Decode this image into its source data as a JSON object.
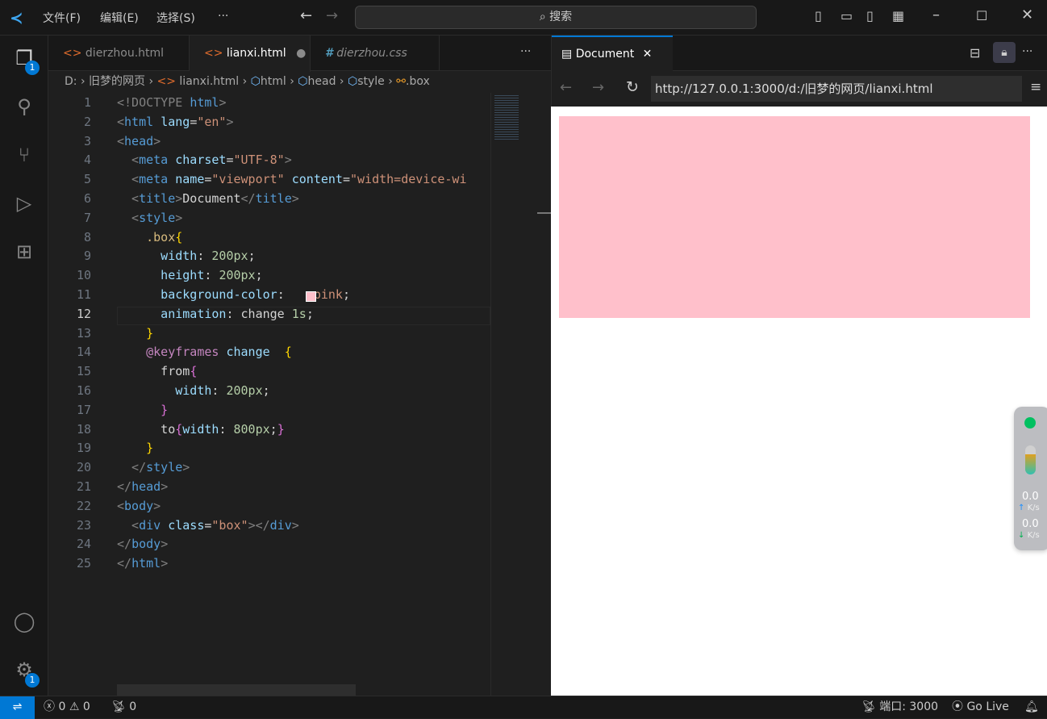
{
  "titlebar": {
    "menus": [
      "文件(F)",
      "编辑(E)",
      "选择(S)",
      "···"
    ],
    "search": "搜索"
  },
  "activity": {
    "explorer_badge": "1",
    "settings_badge": "1"
  },
  "tabs": [
    {
      "label": "dierzhou.html",
      "icon": "html-icon"
    },
    {
      "label": "lianxi.html",
      "icon": "html-icon",
      "modified": true,
      "active": true
    },
    {
      "label": "dierzhou.css",
      "icon": "css-icon"
    }
  ],
  "tabs_more": "···",
  "breadcrumb": [
    "D:",
    "旧梦的网页",
    "lianxi.html",
    "html",
    "head",
    "style",
    ".box"
  ],
  "code": [
    [
      [
        "<!DOCTYPE ",
        "pun"
      ],
      [
        "html",
        "tag"
      ],
      [
        ">",
        "pun"
      ]
    ],
    [
      [
        "<",
        "pun"
      ],
      [
        "html ",
        "tag"
      ],
      [
        "lang",
        "attr"
      ],
      [
        "=",
        "txt"
      ],
      [
        "\"en\"",
        "str"
      ],
      [
        ">",
        "pun"
      ]
    ],
    [
      [
        "<",
        "pun"
      ],
      [
        "head",
        "tag"
      ],
      [
        ">",
        "pun"
      ]
    ],
    [
      [
        "  <",
        "pun"
      ],
      [
        "meta ",
        "tag"
      ],
      [
        "charset",
        "attr"
      ],
      [
        "=",
        "txt"
      ],
      [
        "\"UTF-8\"",
        "str"
      ],
      [
        ">",
        "pun"
      ]
    ],
    [
      [
        "  <",
        "pun"
      ],
      [
        "meta ",
        "tag"
      ],
      [
        "name",
        "attr"
      ],
      [
        "=",
        "txt"
      ],
      [
        "\"viewport\" ",
        "str"
      ],
      [
        "content",
        "attr"
      ],
      [
        "=",
        "txt"
      ],
      [
        "\"width=device-wi",
        "str"
      ]
    ],
    [
      [
        "  <",
        "pun"
      ],
      [
        "title",
        "tag"
      ],
      [
        ">",
        "pun"
      ],
      [
        "Document",
        "txt"
      ],
      [
        "</",
        "pun"
      ],
      [
        "title",
        "tag"
      ],
      [
        ">",
        "pun"
      ]
    ],
    [
      [
        "  <",
        "pun"
      ],
      [
        "style",
        "tag"
      ],
      [
        ">",
        "pun"
      ]
    ],
    [
      [
        "    .box",
        "sel"
      ],
      [
        "{",
        "br1"
      ]
    ],
    [
      [
        "      width",
        "attr"
      ],
      [
        ": ",
        "txt"
      ],
      [
        "200px",
        "num"
      ],
      [
        ";",
        "txt"
      ]
    ],
    [
      [
        "      height",
        "attr"
      ],
      [
        ": ",
        "txt"
      ],
      [
        "200px",
        "num"
      ],
      [
        ";",
        "txt"
      ]
    ],
    [
      [
        "      background-color",
        "attr"
      ],
      [
        ": ",
        "txt"
      ],
      [
        "   pink",
        "str"
      ],
      [
        ";",
        "txt"
      ]
    ],
    [
      [
        "      animation",
        "attr"
      ],
      [
        ": change ",
        "txt"
      ],
      [
        "1s",
        "num"
      ],
      [
        ";",
        "txt"
      ]
    ],
    [
      [
        "    }",
        "br1"
      ]
    ],
    [
      [
        "    @keyframes ",
        "at"
      ],
      [
        "change  ",
        "attr"
      ],
      [
        "{",
        "br1"
      ]
    ],
    [
      [
        "      from",
        "txt"
      ],
      [
        "{",
        "br2"
      ]
    ],
    [
      [
        "        width",
        "attr"
      ],
      [
        ": ",
        "txt"
      ],
      [
        "200px",
        "num"
      ],
      [
        ";",
        "txt"
      ]
    ],
    [
      [
        "      }",
        "br2"
      ]
    ],
    [
      [
        "      to",
        "txt"
      ],
      [
        "{",
        "br2"
      ],
      [
        "width",
        "attr"
      ],
      [
        ": ",
        "txt"
      ],
      [
        "800px",
        "num"
      ],
      [
        ";",
        "txt"
      ],
      [
        "}",
        "br2"
      ]
    ],
    [
      [
        "    }",
        "br1"
      ]
    ],
    [
      [
        "  </",
        "pun"
      ],
      [
        "style",
        "tag"
      ],
      [
        ">",
        "pun"
      ]
    ],
    [
      [
        "</",
        "pun"
      ],
      [
        "head",
        "tag"
      ],
      [
        ">",
        "pun"
      ]
    ],
    [
      [
        "<",
        "pun"
      ],
      [
        "body",
        "tag"
      ],
      [
        ">",
        "pun"
      ]
    ],
    [
      [
        "  <",
        "pun"
      ],
      [
        "div ",
        "tag"
      ],
      [
        "class",
        "attr"
      ],
      [
        "=",
        "txt"
      ],
      [
        "\"box\"",
        "str"
      ],
      [
        "></",
        "pun"
      ],
      [
        "div",
        "tag"
      ],
      [
        ">",
        "pun"
      ]
    ],
    [
      [
        "</",
        "pun"
      ],
      [
        "body",
        "tag"
      ],
      [
        ">",
        "pun"
      ]
    ],
    [
      [
        "</",
        "pun"
      ],
      [
        "html",
        "tag"
      ],
      [
        ">",
        "pun"
      ]
    ]
  ],
  "active_line": 12,
  "preview": {
    "tab": "Document",
    "url": "http://127.0.0.1:3000/d:/旧梦的网页/lianxi.html",
    "box_color": "#ffc0cb"
  },
  "widget": {
    "up": "0.0",
    "up_unit": "K/s",
    "down": "0.0",
    "down_unit": "K/s"
  },
  "statusbar": {
    "errors": "0",
    "warnings": "0",
    "ports": "0",
    "port_label": "端口: 3000",
    "golive": "Go Live"
  }
}
